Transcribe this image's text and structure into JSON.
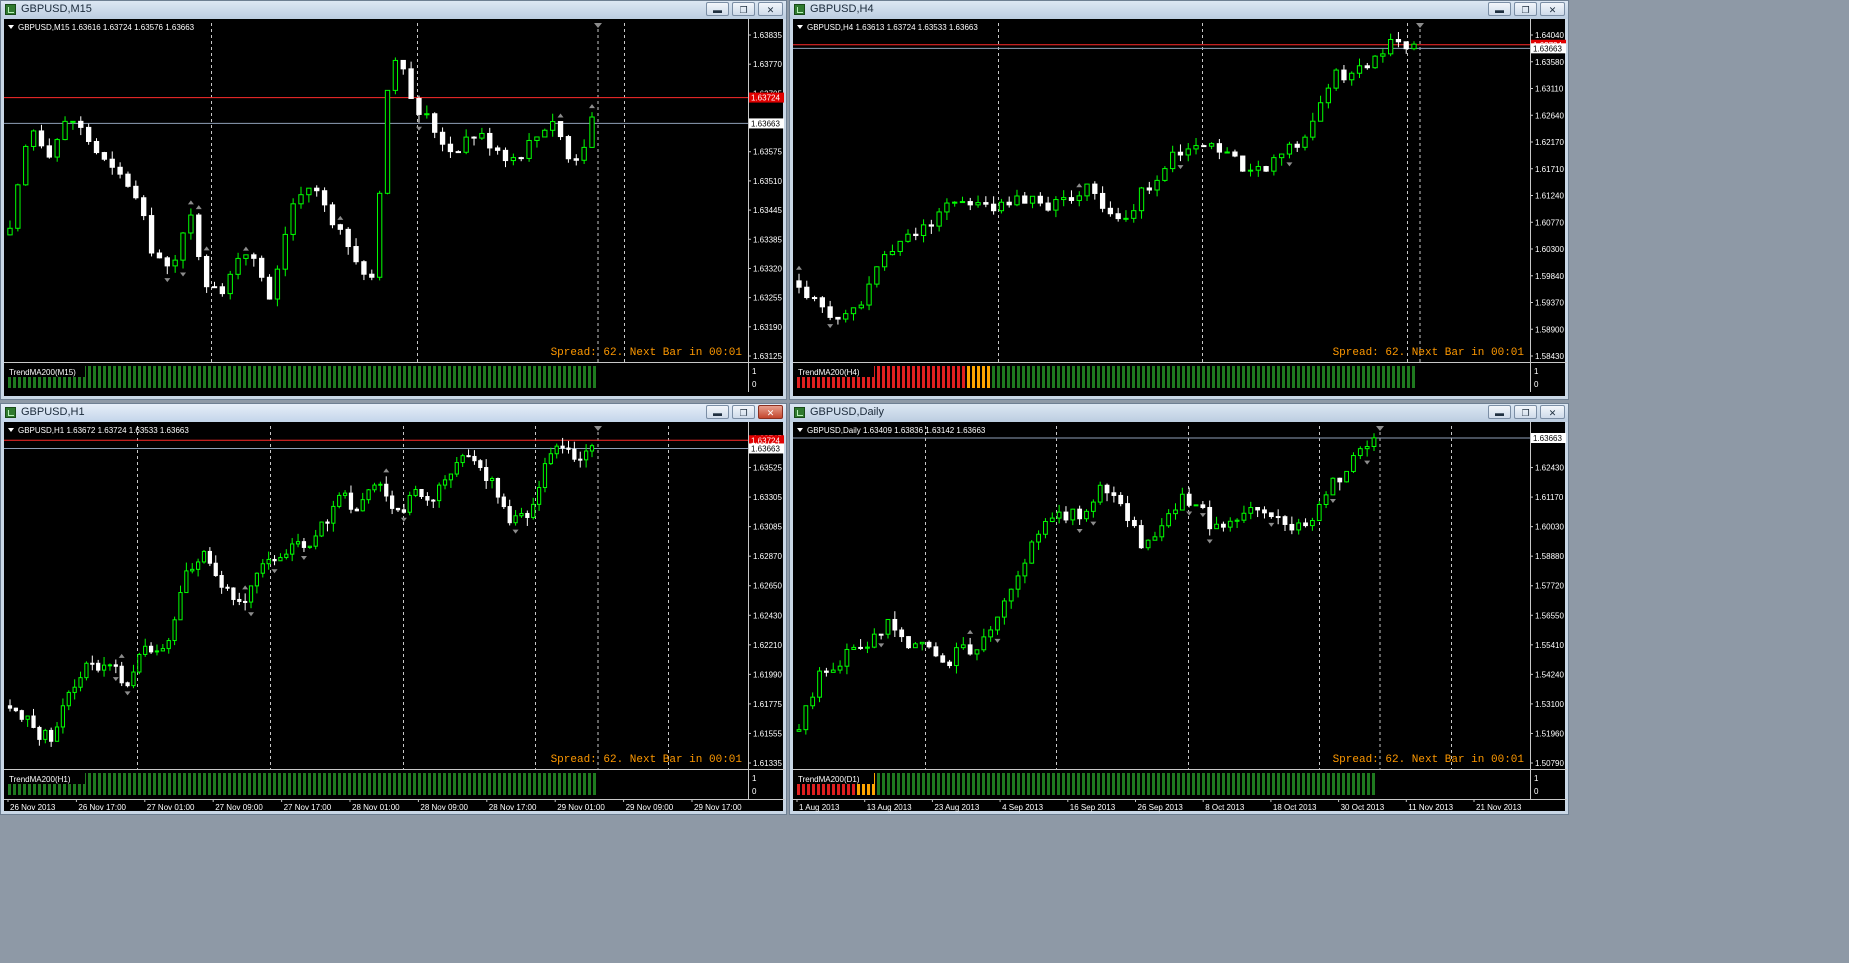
{
  "colors": {
    "background": "#000000",
    "bull": "#00ff00",
    "bear": "#ffffff",
    "grid": "#c8c8c8",
    "ask_line": "#ff2b2b",
    "bid_line": "#8fa0b8",
    "spread_text": "#ff9900",
    "trend_up": "#1f7a1f",
    "trend_flat": "#ffa500",
    "trend_down": "#e02020",
    "fractal": "#8c8c8c"
  },
  "windows": [
    {
      "id": "m15",
      "title": "GBPUSD,M15",
      "active": false,
      "buttons": [
        "minimize",
        "restore",
        "close"
      ],
      "chart_header": "GBPUSD,M15  1.63616 1.63724 1.63576 1.63663",
      "spread_text": "Spread: 62. Next Bar in 00:01",
      "indicator_label": "TrendMA200(M15)",
      "indicator_scale": [
        "1",
        "0"
      ],
      "ask_label": "1.63724",
      "bid_label": "1.63663",
      "time_labels": [],
      "trend": {
        "red": 0,
        "orange": 0,
        "green": 1
      }
    },
    {
      "id": "h4",
      "title": "GBPUSD,H4",
      "active": false,
      "buttons": [
        "minimize",
        "restore",
        "close"
      ],
      "chart_header": "GBPUSD,H4  1.63613 1.63724 1.63533 1.63663",
      "spread_text": "Spread: 62. Next Bar in 00:01",
      "indicator_label": "TrendMA200(H4)",
      "indicator_scale": [
        "1",
        "0"
      ],
      "ask_label": "1.63724",
      "bid_label": "1.63663",
      "time_labels": [],
      "trend": {
        "red": 0.27,
        "orange": 0.04,
        "green": 0.69
      }
    },
    {
      "id": "h1",
      "title": "GBPUSD,H1",
      "active": true,
      "buttons": [
        "minimize",
        "restore",
        "close"
      ],
      "chart_header": "GBPUSD,H1  1.63672 1.63724 1.63533 1.63663",
      "spread_text": "Spread: 62. Next Bar in 00:01",
      "indicator_label": "TrendMA200(H1)",
      "indicator_scale": [
        "1",
        "0"
      ],
      "ask_label": "1.63724",
      "bid_label": "1.63663",
      "time_labels": [
        "26 Nov 2013",
        "26 Nov 17:00",
        "27 Nov 01:00",
        "27 Nov 09:00",
        "27 Nov 17:00",
        "28 Nov 01:00",
        "28 Nov 09:00",
        "28 Nov 17:00",
        "29 Nov 01:00",
        "29 Nov 09:00",
        "29 Nov 17:00"
      ],
      "trend": {
        "red": 0,
        "orange": 0,
        "green": 1
      }
    },
    {
      "id": "d1",
      "title": "GBPUSD,Daily",
      "active": false,
      "buttons": [
        "minimize",
        "restore",
        "close"
      ],
      "chart_header": "GBPUSD,Daily  1.63409 1.63836 1.63142 1.63663",
      "spread_text": "Spread: 62. Next Bar in 00:01",
      "indicator_label": "TrendMA200(D1)",
      "indicator_scale": [
        "1",
        "0"
      ],
      "ask_label": "",
      "bid_label": "1.63663",
      "time_labels": [
        "1 Aug 2013",
        "13 Aug 2013",
        "23 Aug 2013",
        "4 Sep 2013",
        "16 Sep 2013",
        "26 Sep 2013",
        "8 Oct 2013",
        "18 Oct 2013",
        "30 Oct 2013",
        "11 Nov 2013",
        "21 Nov 2013"
      ],
      "trend": {
        "red": 0.1,
        "orange": 0.03,
        "green": 0.87
      }
    }
  ],
  "chart_data": [
    {
      "type": "candlestick",
      "window": "GBPUSD,M15",
      "y_ticks": [
        "1.63835",
        "1.63770",
        "1.63705",
        "1.63640",
        "1.63575",
        "1.63510",
        "1.63445",
        "1.63385",
        "1.63320",
        "1.63255",
        "1.63190",
        "1.63125"
      ],
      "ylim": [
        1.631,
        1.639
      ],
      "bars": 75,
      "close_path": [
        1.634,
        1.6366,
        1.636,
        1.6368,
        1.6362,
        1.6355,
        1.6352,
        1.6338,
        1.633,
        1.6345,
        1.6325,
        1.633,
        1.6338,
        1.6324,
        1.6347,
        1.6352,
        1.6345,
        1.6336,
        1.6327,
        1.6385,
        1.6372,
        1.6366,
        1.636,
        1.6364,
        1.6362,
        1.6358,
        1.6362,
        1.6368,
        1.6357,
        1.6366
      ],
      "ask": 1.63724,
      "bid": 1.63663
    },
    {
      "type": "candlestick",
      "window": "GBPUSD,H4",
      "y_ticks": [
        "1.64040",
        "1.63580",
        "1.63110",
        "1.62640",
        "1.62170",
        "1.61710",
        "1.61240",
        "1.60770",
        "1.60300",
        "1.59840",
        "1.59370",
        "1.58900",
        "1.58430"
      ],
      "ylim": [
        1.5825,
        1.641
      ],
      "bars": 80,
      "close_path": [
        1.5965,
        1.592,
        1.5898,
        1.5935,
        1.6005,
        1.6032,
        1.606,
        1.6085,
        1.6112,
        1.6095,
        1.609,
        1.611,
        1.61,
        1.6102,
        1.6132,
        1.6095,
        1.6065,
        1.613,
        1.6175,
        1.6182,
        1.6205,
        1.6175,
        1.615,
        1.6165,
        1.6195,
        1.624,
        1.6315,
        1.632,
        1.635,
        1.6375,
        1.6362
      ],
      "ask": 1.63724,
      "bid": 1.63663
    },
    {
      "type": "candlestick",
      "window": "GBPUSD,H1",
      "y_ticks": [
        "1.63745",
        "1.63525",
        "1.63305",
        "1.63085",
        "1.62870",
        "1.62650",
        "1.62430",
        "1.62210",
        "1.61990",
        "1.61775",
        "1.61555",
        "1.61335"
      ],
      "ylim": [
        1.6128,
        1.6383
      ],
      "bars": 100,
      "close_path": [
        1.6175,
        1.616,
        1.615,
        1.618,
        1.621,
        1.6205,
        1.6195,
        1.6215,
        1.6215,
        1.6275,
        1.629,
        1.6265,
        1.6255,
        1.6275,
        1.6285,
        1.6295,
        1.6305,
        1.633,
        1.632,
        1.634,
        1.632,
        1.6335,
        1.633,
        1.6355,
        1.6355,
        1.6335,
        1.631,
        1.6325,
        1.637,
        1.636,
        1.6366
      ],
      "ask": 1.63724,
      "bid": 1.63663
    },
    {
      "type": "candlestick",
      "window": "GBPUSD,Daily",
      "y_ticks": [
        "1.63663",
        "1.62430",
        "1.61170",
        "1.60030",
        "1.58880",
        "1.57720",
        "1.56550",
        "1.55410",
        "1.54240",
        "1.53100",
        "1.51960",
        "1.50790"
      ],
      "ylim": [
        1.504,
        1.6405
      ],
      "bars": 85,
      "close_path": [
        1.519,
        1.542,
        1.548,
        1.554,
        1.562,
        1.556,
        1.55,
        1.548,
        1.552,
        1.559,
        1.574,
        1.593,
        1.606,
        1.604,
        1.615,
        1.609,
        1.594,
        1.6,
        1.612,
        1.605,
        1.598,
        1.605,
        1.604,
        1.6,
        1.605,
        1.616,
        1.625,
        1.6366
      ]
    }
  ]
}
